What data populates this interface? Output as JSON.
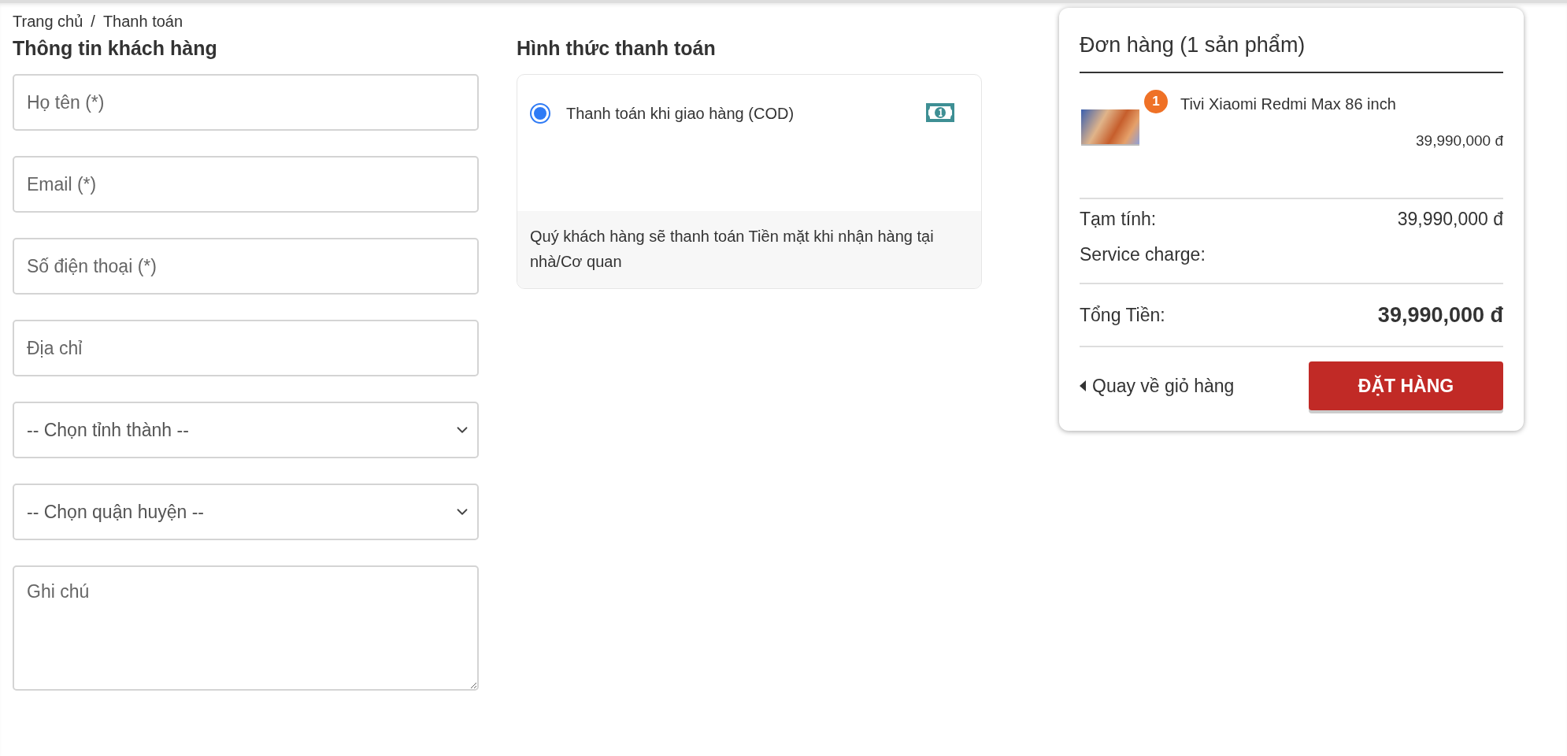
{
  "breadcrumb": {
    "items": [
      {
        "label": "Trang chủ"
      },
      {
        "label": "Thanh toán"
      }
    ],
    "separator": "/"
  },
  "customer": {
    "title": "Thông tin khách hàng",
    "fields": [
      {
        "kind": "input",
        "placeholder": "Họ tên (*)"
      },
      {
        "kind": "input",
        "placeholder": "Email (*)"
      },
      {
        "kind": "input",
        "placeholder": "Số điện thoại (*)"
      },
      {
        "kind": "input",
        "placeholder": "Địa chỉ"
      },
      {
        "kind": "select",
        "value": "-- Chọn tỉnh thành --"
      },
      {
        "kind": "select",
        "value": "-- Chọn quận huyện --"
      },
      {
        "kind": "textarea",
        "placeholder": "Ghi chú"
      }
    ]
  },
  "payment": {
    "title": "Hình thức thanh toán",
    "methods": [
      {
        "label": "Thanh toán khi giao hàng (COD)",
        "selected": true,
        "description": "Quý khách hàng sẽ thanh toán Tiền mặt khi nhận hàng tại nhà/Cơ quan"
      }
    ]
  },
  "order": {
    "title": "Đơn hàng (1 sản phẩm)",
    "items": [
      {
        "name": "Tivi Xiaomi Redmi Max 86 inch",
        "quantity": "1",
        "price": "39,990,000 đ"
      }
    ],
    "subtotal_label": "Tạm tính:",
    "subtotal_value": "39,990,000 đ",
    "service_label": "Service charge:",
    "total_label": "Tổng Tiền:",
    "total_value": "39,990,000 đ",
    "back_link": "Quay về giỏ hàng",
    "submit": "ĐẶT HÀNG"
  }
}
